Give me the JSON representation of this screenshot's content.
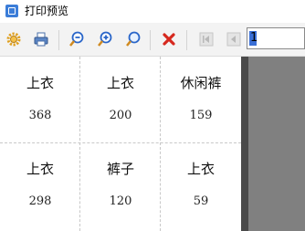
{
  "window": {
    "title": "打印预览"
  },
  "toolbar": {
    "buttons": [
      {
        "name": "settings",
        "icon": "gear-icon"
      },
      {
        "name": "print",
        "icon": "printer-icon"
      },
      {
        "name": "zoom-out",
        "icon": "zoom-out-icon"
      },
      {
        "name": "zoom-in",
        "icon": "zoom-in-icon"
      },
      {
        "name": "zoom-fit",
        "icon": "zoom-fit-icon"
      },
      {
        "name": "close",
        "icon": "close-icon"
      },
      {
        "name": "first-page",
        "icon": "first-page-icon"
      },
      {
        "name": "prev-page",
        "icon": "prev-page-icon"
      }
    ],
    "page_number": "1"
  },
  "labels": {
    "rows": [
      [
        {
          "name": "上衣",
          "qty": "368"
        },
        {
          "name": "上衣",
          "qty": "200"
        },
        {
          "name": "休闲裤",
          "qty": "159"
        }
      ],
      [
        {
          "name": "上衣",
          "qty": "298"
        },
        {
          "name": "裤子",
          "qty": "120"
        },
        {
          "name": "上衣",
          "qty": "59"
        }
      ]
    ]
  },
  "colors": {
    "accent": "#3a6fd6",
    "close": "#d6281e",
    "gear": "#e0a020"
  }
}
